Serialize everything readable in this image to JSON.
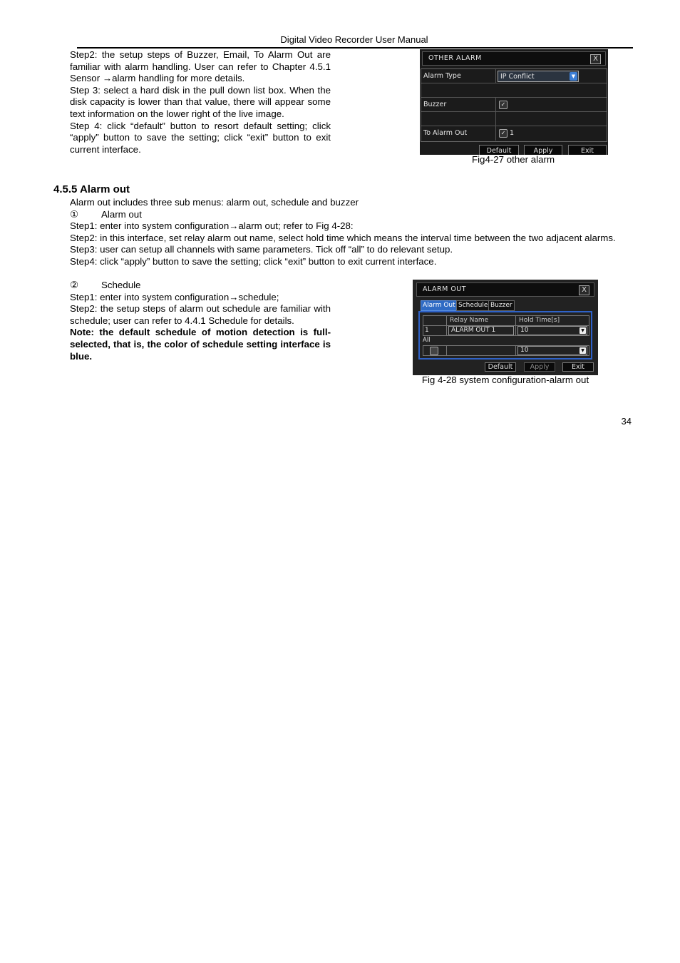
{
  "header": {
    "title": "Digital Video Recorder User Manual"
  },
  "intro_paragraphs": [
    "Step2:  the setup steps of Buzzer, Email, To Alarm Out are familiar with alarm handling. User can refer to Chapter 4.5.1 Sensor →alarm handling for more details.",
    "Step 3: select a hard disk in the pull down list box. When the disk capacity is lower than that value, there will appear some text information on the lower right of the live image.",
    "Step 4: click “default” button to resort default setting; click “apply” button to save the setting; click “exit” button to exit current interface."
  ],
  "figure_other_alarm": {
    "title": "OTHER ALARM",
    "close_label": "X",
    "rows": [
      {
        "label": "Alarm Type",
        "value": "IP Conflict",
        "kind": "select"
      },
      {
        "label": "",
        "value": "",
        "kind": "empty"
      },
      {
        "label": "Buzzer",
        "value": "",
        "kind": "checkbox",
        "checked": true
      },
      {
        "label": "",
        "value": "",
        "kind": "empty"
      },
      {
        "label": "To Alarm Out",
        "value": "1",
        "kind": "checkbox",
        "checked": true
      }
    ],
    "buttons": {
      "default": "Default",
      "apply": "Apply",
      "exit": "Exit"
    },
    "caption": "Fig4-27 other alarm"
  },
  "section": {
    "heading": "4.5.5  Alarm out",
    "intro": "Alarm out includes three sub menus: alarm out, schedule and buzzer",
    "sub1": {
      "marker": "①",
      "title": "Alarm out"
    },
    "sub1_steps": [
      "Step1: enter into system configuration→alarm out; refer to Fig 4-28:",
      "Step2: in this interface, set relay alarm out name, select hold time which means the interval time between the two adjacent alarms.",
      "Step3: user can setup all channels with same parameters. Tick off “all” to do relevant setup.",
      "Step4: click “apply” button to save the setting; click “exit” button to exit current interface."
    ],
    "sub2": {
      "marker": "②",
      "title": "Schedule"
    },
    "sub2_steps": [
      "Step1: enter into system configuration→schedule;",
      "Step2: the setup steps of alarm out schedule are familiar with schedule; user can refer to 4.4.1 Schedule for details."
    ],
    "note": "Note: the default schedule of motion detection is full-selected, that is, the color of schedule setting interface is blue."
  },
  "figure_alarm_out": {
    "title": "ALARM OUT",
    "close_label": "X",
    "tabs": [
      {
        "label": "Alarm Out",
        "active": true
      },
      {
        "label": "Schedule",
        "active": false
      },
      {
        "label": "Buzzer",
        "active": false
      }
    ],
    "columns": [
      "",
      "Relay Name",
      "Hold Time[s]"
    ],
    "rows": [
      {
        "index": "1",
        "relay_name": "ALARM OUT 1",
        "hold_time": "10"
      }
    ],
    "all_label": "All",
    "all_row": {
      "checked": false,
      "hold_time": "10"
    },
    "buttons": {
      "default": "Default",
      "apply": "Apply",
      "exit": "Exit"
    },
    "caption": "Fig 4-28 system configuration-alarm out"
  },
  "footer": {
    "page_number": "34"
  }
}
